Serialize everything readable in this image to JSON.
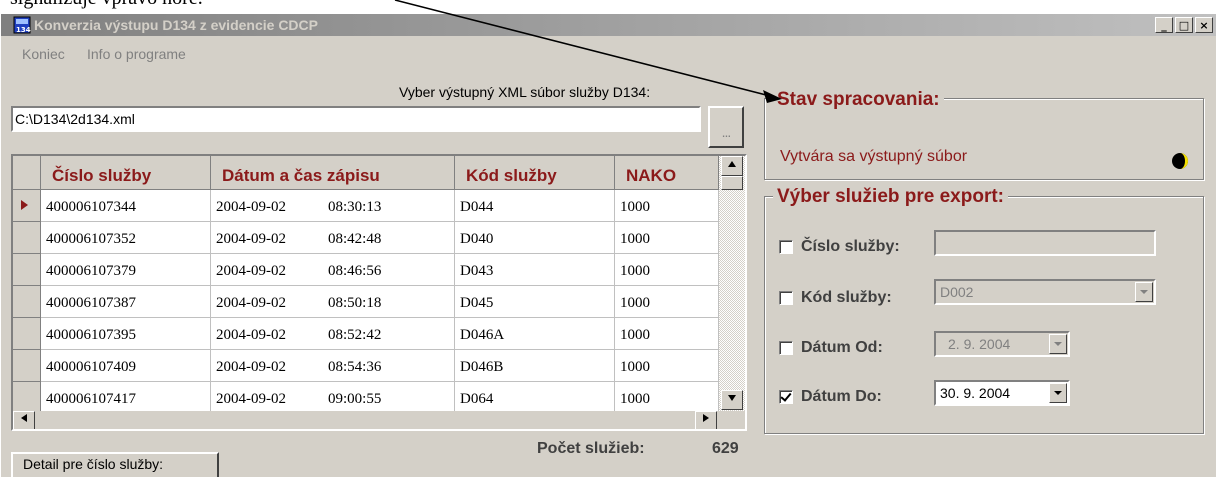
{
  "doc_text": "signalizuje vpravo hore.",
  "window": {
    "title": "Konverzia výstupu D134 z evidencie CDCP",
    "controls": {
      "minimize": "_",
      "maximize": "□",
      "close": "×"
    }
  },
  "menu": {
    "items": [
      "Koniec",
      "Info o programe"
    ]
  },
  "file": {
    "label": "Vyber výstupný XML súbor služby D134:",
    "path": "C:\\D134\\2d134.xml",
    "browse": "..."
  },
  "grid": {
    "columns": [
      "Číslo služby",
      "Dátum a čas zápisu",
      "Kód služby",
      "NAKO"
    ],
    "rows": [
      {
        "num": "400006107344",
        "date": "2004-09-02",
        "time": "08:30:13",
        "kod": "D044",
        "nako": "1000",
        "current": true
      },
      {
        "num": "400006107352",
        "date": "2004-09-02",
        "time": "08:42:48",
        "kod": "D040",
        "nako": "1000"
      },
      {
        "num": "400006107379",
        "date": "2004-09-02",
        "time": "08:46:56",
        "kod": "D043",
        "nako": "1000"
      },
      {
        "num": "400006107387",
        "date": "2004-09-02",
        "time": "08:50:18",
        "kod": "D045",
        "nako": "1000"
      },
      {
        "num": "400006107395",
        "date": "2004-09-02",
        "time": "08:52:42",
        "kod": "D046A",
        "nako": "1000"
      },
      {
        "num": "400006107409",
        "date": "2004-09-02",
        "time": "08:54:36",
        "kod": "D046B",
        "nako": "1000"
      },
      {
        "num": "400006107417",
        "date": "2004-09-02",
        "time": "09:00:55",
        "kod": "D064",
        "nako": "1000"
      }
    ]
  },
  "count": {
    "label": "Počet služieb:",
    "value": "629"
  },
  "detail_button": "Detail pre číslo služby:",
  "status": {
    "title": "Stav spracovania:",
    "text": "Vytvára sa výstupný súbor"
  },
  "export": {
    "title": "Výber služieb pre export:",
    "cislo": {
      "label": "Číslo služby:",
      "checked": false,
      "value": ""
    },
    "kod": {
      "label": "Kód služby:",
      "checked": false,
      "value": "D002"
    },
    "od": {
      "label": "Dátum Od:",
      "checked": false,
      "value": "2. 9. 2004"
    },
    "do": {
      "label": "Dátum Do:",
      "checked": true,
      "value": "30. 9. 2004"
    }
  },
  "colors": {
    "accent": "#8b1a1a",
    "face": "#d4d0c8"
  }
}
